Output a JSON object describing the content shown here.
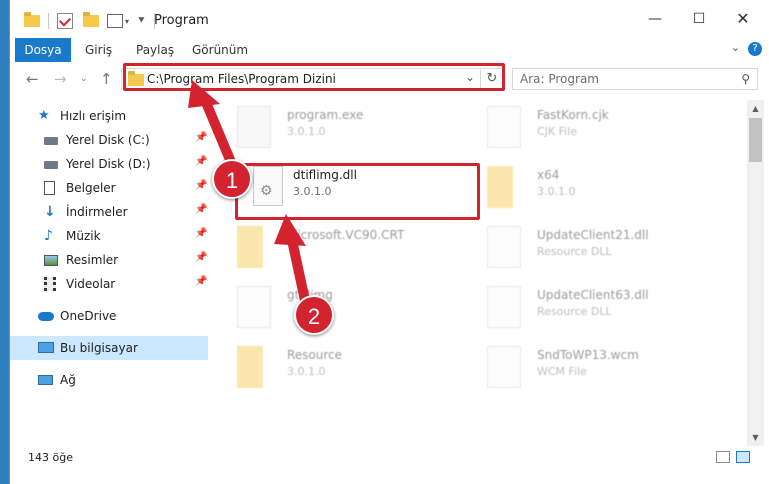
{
  "window": {
    "title": "Program",
    "controls": [
      "minimize-button",
      "maximize-button",
      "close-button"
    ]
  },
  "ribbon": {
    "file_tab": "Dosya",
    "tabs": [
      "Giriş",
      "Paylaş",
      "Görünüm"
    ]
  },
  "navbar": {
    "address": "C:\\Program Files\\Program Dizini",
    "search_placeholder": "Ara: Program"
  },
  "sidebar": {
    "quick_access": "Hızlı erişim",
    "items": [
      {
        "label": "Yerel Disk (C:)",
        "icon": "drive-icon"
      },
      {
        "label": "Yerel Disk (D:)",
        "icon": "drive-icon"
      },
      {
        "label": "Belgeler",
        "icon": "documents-icon"
      },
      {
        "label": "İndirmeler",
        "icon": "download-icon"
      },
      {
        "label": "Müzik",
        "icon": "music-icon"
      },
      {
        "label": "Resimler",
        "icon": "pictures-icon"
      },
      {
        "label": "Videolar",
        "icon": "videos-icon"
      }
    ],
    "onedrive": "OneDrive",
    "this_pc": "Bu bilgisayar",
    "network": "Ağ"
  },
  "files": {
    "left": [
      {
        "name": "program.exe",
        "sub": "3.0.1.0"
      },
      {
        "name": "dtiflimg.dll",
        "sub": "3.0.1.0"
      },
      {
        "name": "Microsoft.VC90.CRT",
        "sub": ""
      },
      {
        "name": "gtiflimg",
        "sub": ""
      },
      {
        "name": "Resource",
        "sub": "3.0.1.0"
      }
    ],
    "right": [
      {
        "name": "FastKorn.cjk",
        "sub": "CJK File"
      },
      {
        "name": "x64",
        "sub": "3.0.1.0"
      },
      {
        "name": "UpdateClient21.dll",
        "sub": "Resource DLL"
      },
      {
        "name": "UpdateClient63.dll",
        "sub": "Resource DLL"
      },
      {
        "name": "SndToWP13.wcm",
        "sub": "WCM File"
      }
    ]
  },
  "status": {
    "count": "143 öğe"
  },
  "annotations": {
    "step1": "1",
    "step2": "2"
  },
  "colors": {
    "accent": "#1979ca",
    "highlight": "#d3232f",
    "selected": "#cce8ff"
  }
}
